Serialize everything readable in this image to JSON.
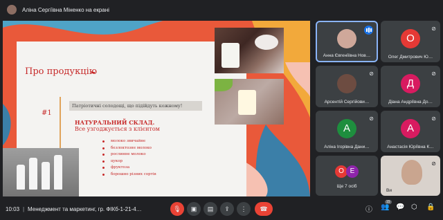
{
  "top": {
    "presenter_label": "Аліна Сергіївна Міненко на екрані"
  },
  "slide": {
    "title": "Про продукцію",
    "tagline": "Патріотичні солодощі, що підійдуть кожному!",
    "number": "#1",
    "subtitle": "НАТУРАЛЬНИЙ СКЛАД.",
    "subtitle2": "Все узгоджується  з клієнтом",
    "items": [
      "молоко звичайне",
      "безлоктозне молоко",
      "рослинне молоко",
      "цукор",
      "фруктоза",
      "борошно різних сортів"
    ]
  },
  "participants": {
    "p1": {
      "name": "Анна Євгеніївна Нов…"
    },
    "p2": {
      "initial": "О",
      "name": "Олег Дмитрович Ю…",
      "color": "#e53935"
    },
    "p3": {
      "name": "Арсентій Сергійови…"
    },
    "p4": {
      "initial": "Д",
      "name": "Діана Андріївна До…",
      "color": "#d81b60"
    },
    "p5": {
      "initial": "А",
      "name": "Аліна Ігорівна Дани…",
      "color": "#1e8e3e"
    },
    "p6": {
      "initial": "А",
      "name": "Анастасія Юріївна К…",
      "color": "#d81b60"
    },
    "more": {
      "label": "Ще 7 осіб",
      "i1": "О",
      "i2": "Е"
    },
    "self": {
      "label": "Ви"
    }
  },
  "bottom": {
    "time": "10:03",
    "separator": "|",
    "meeting": "Менеджмент та маркетинг, гр. ФІКб-1-21-4…",
    "people_count": "15"
  },
  "colors": {
    "accent": "#8ab4f8",
    "end_call": "#ea4335",
    "slide_red": "#c62828"
  }
}
